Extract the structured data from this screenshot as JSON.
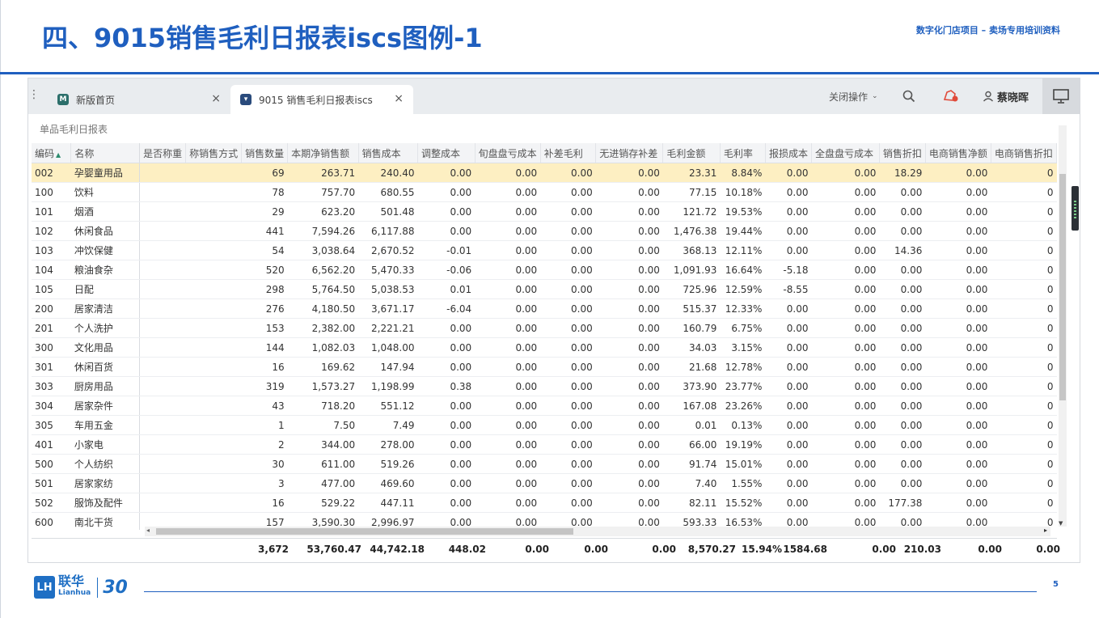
{
  "slide": {
    "title": "四、9015销售毛利日报表iscs图例-1",
    "subtitle": "数字化门店项目 – 卖场专用培训资料",
    "page_number": "5",
    "logo_cn": "联华",
    "logo_en": "Lianhua",
    "logo_anniversary": "30"
  },
  "tabs": [
    {
      "label": "新版首页",
      "close": "×"
    },
    {
      "label": "9015 销售毛利日报表iscs",
      "close": "×"
    }
  ],
  "toolbar": {
    "close_ops": "关闭操作",
    "user_name": "蔡晓晖"
  },
  "icons": {
    "search": "search-icon",
    "bell": "notification-icon",
    "user": "user-icon",
    "monitor": "monitor-icon",
    "brand_color": "#1f5fbf"
  },
  "report": {
    "label": "单品毛利日报表"
  },
  "table": {
    "columns": [
      "编码",
      "名称",
      "是否称重",
      "称销售方式",
      "销售数量",
      "本期净销售额",
      "销售成本",
      "调整成本",
      "旬盘盘亏成本",
      "补差毛利",
      "无进销存补差",
      "毛利金额",
      "毛利率",
      "报损成本",
      "全盘盘亏成本",
      "销售折扣",
      "电商销售净额",
      "电商销售折扣"
    ],
    "rows": [
      [
        "002",
        "孕婴童用品",
        "",
        "",
        "69",
        "263.71",
        "240.40",
        "0.00",
        "0.00",
        "0.00",
        "0.00",
        "23.31",
        "8.84%",
        "0.00",
        "0.00",
        "18.29",
        "0.00",
        "0"
      ],
      [
        "100",
        "饮料",
        "",
        "",
        "78",
        "757.70",
        "680.55",
        "0.00",
        "0.00",
        "0.00",
        "0.00",
        "77.15",
        "10.18%",
        "0.00",
        "0.00",
        "0.00",
        "0.00",
        "0"
      ],
      [
        "101",
        "烟酒",
        "",
        "",
        "29",
        "623.20",
        "501.48",
        "0.00",
        "0.00",
        "0.00",
        "0.00",
        "121.72",
        "19.53%",
        "0.00",
        "0.00",
        "0.00",
        "0.00",
        "0"
      ],
      [
        "102",
        "休闲食品",
        "",
        "",
        "441",
        "7,594.26",
        "6,117.88",
        "0.00",
        "0.00",
        "0.00",
        "0.00",
        "1,476.38",
        "19.44%",
        "0.00",
        "0.00",
        "0.00",
        "0.00",
        "0"
      ],
      [
        "103",
        "冲饮保健",
        "",
        "",
        "54",
        "3,038.64",
        "2,670.52",
        "-0.01",
        "0.00",
        "0.00",
        "0.00",
        "368.13",
        "12.11%",
        "0.00",
        "0.00",
        "14.36",
        "0.00",
        "0"
      ],
      [
        "104",
        "粮油食杂",
        "",
        "",
        "520",
        "6,562.20",
        "5,470.33",
        "-0.06",
        "0.00",
        "0.00",
        "0.00",
        "1,091.93",
        "16.64%",
        "-5.18",
        "0.00",
        "0.00",
        "0.00",
        "0"
      ],
      [
        "105",
        "日配",
        "",
        "",
        "298",
        "5,764.50",
        "5,038.53",
        "0.01",
        "0.00",
        "0.00",
        "0.00",
        "725.96",
        "12.59%",
        "-8.55",
        "0.00",
        "0.00",
        "0.00",
        "0"
      ],
      [
        "200",
        "居家清洁",
        "",
        "",
        "276",
        "4,180.50",
        "3,671.17",
        "-6.04",
        "0.00",
        "0.00",
        "0.00",
        "515.37",
        "12.33%",
        "0.00",
        "0.00",
        "0.00",
        "0.00",
        "0"
      ],
      [
        "201",
        "个人洗护",
        "",
        "",
        "153",
        "2,382.00",
        "2,221.21",
        "0.00",
        "0.00",
        "0.00",
        "0.00",
        "160.79",
        "6.75%",
        "0.00",
        "0.00",
        "0.00",
        "0.00",
        "0"
      ],
      [
        "300",
        "文化用品",
        "",
        "",
        "144",
        "1,082.03",
        "1,048.00",
        "0.00",
        "0.00",
        "0.00",
        "0.00",
        "34.03",
        "3.15%",
        "0.00",
        "0.00",
        "0.00",
        "0.00",
        "0"
      ],
      [
        "301",
        "休闲百货",
        "",
        "",
        "16",
        "169.62",
        "147.94",
        "0.00",
        "0.00",
        "0.00",
        "0.00",
        "21.68",
        "12.78%",
        "0.00",
        "0.00",
        "0.00",
        "0.00",
        "0"
      ],
      [
        "303",
        "厨房用品",
        "",
        "",
        "319",
        "1,573.27",
        "1,198.99",
        "0.38",
        "0.00",
        "0.00",
        "0.00",
        "373.90",
        "23.77%",
        "0.00",
        "0.00",
        "0.00",
        "0.00",
        "0"
      ],
      [
        "304",
        "居家杂件",
        "",
        "",
        "43",
        "718.20",
        "551.12",
        "0.00",
        "0.00",
        "0.00",
        "0.00",
        "167.08",
        "23.26%",
        "0.00",
        "0.00",
        "0.00",
        "0.00",
        "0"
      ],
      [
        "305",
        "车用五金",
        "",
        "",
        "1",
        "7.50",
        "7.49",
        "0.00",
        "0.00",
        "0.00",
        "0.00",
        "0.01",
        "0.13%",
        "0.00",
        "0.00",
        "0.00",
        "0.00",
        "0"
      ],
      [
        "401",
        "小家电",
        "",
        "",
        "2",
        "344.00",
        "278.00",
        "0.00",
        "0.00",
        "0.00",
        "0.00",
        "66.00",
        "19.19%",
        "0.00",
        "0.00",
        "0.00",
        "0.00",
        "0"
      ],
      [
        "500",
        "个人纺织",
        "",
        "",
        "30",
        "611.00",
        "519.26",
        "0.00",
        "0.00",
        "0.00",
        "0.00",
        "91.74",
        "15.01%",
        "0.00",
        "0.00",
        "0.00",
        "0.00",
        "0"
      ],
      [
        "501",
        "居家家纺",
        "",
        "",
        "3",
        "477.00",
        "469.60",
        "0.00",
        "0.00",
        "0.00",
        "0.00",
        "7.40",
        "1.55%",
        "0.00",
        "0.00",
        "0.00",
        "0.00",
        "0"
      ],
      [
        "502",
        "服饰及配件",
        "",
        "",
        "16",
        "529.22",
        "447.11",
        "0.00",
        "0.00",
        "0.00",
        "0.00",
        "82.11",
        "15.52%",
        "0.00",
        "0.00",
        "177.38",
        "0.00",
        "0"
      ],
      [
        "600",
        "南北干货",
        "",
        "",
        "157",
        "3,590.30",
        "2,996.97",
        "0.00",
        "0.00",
        "0.00",
        "0.00",
        "593.33",
        "16.53%",
        "0.00",
        "0.00",
        "0.00",
        "0.00",
        "0"
      ]
    ],
    "totals": [
      "3,672",
      "53,760.47",
      "44,742.18",
      "448.02",
      "0.00",
      "0.00",
      "0.00",
      "8,570.27",
      "15.94%",
      "1584.68",
      "0.00",
      "210.03",
      "0.00",
      "0.00"
    ]
  }
}
